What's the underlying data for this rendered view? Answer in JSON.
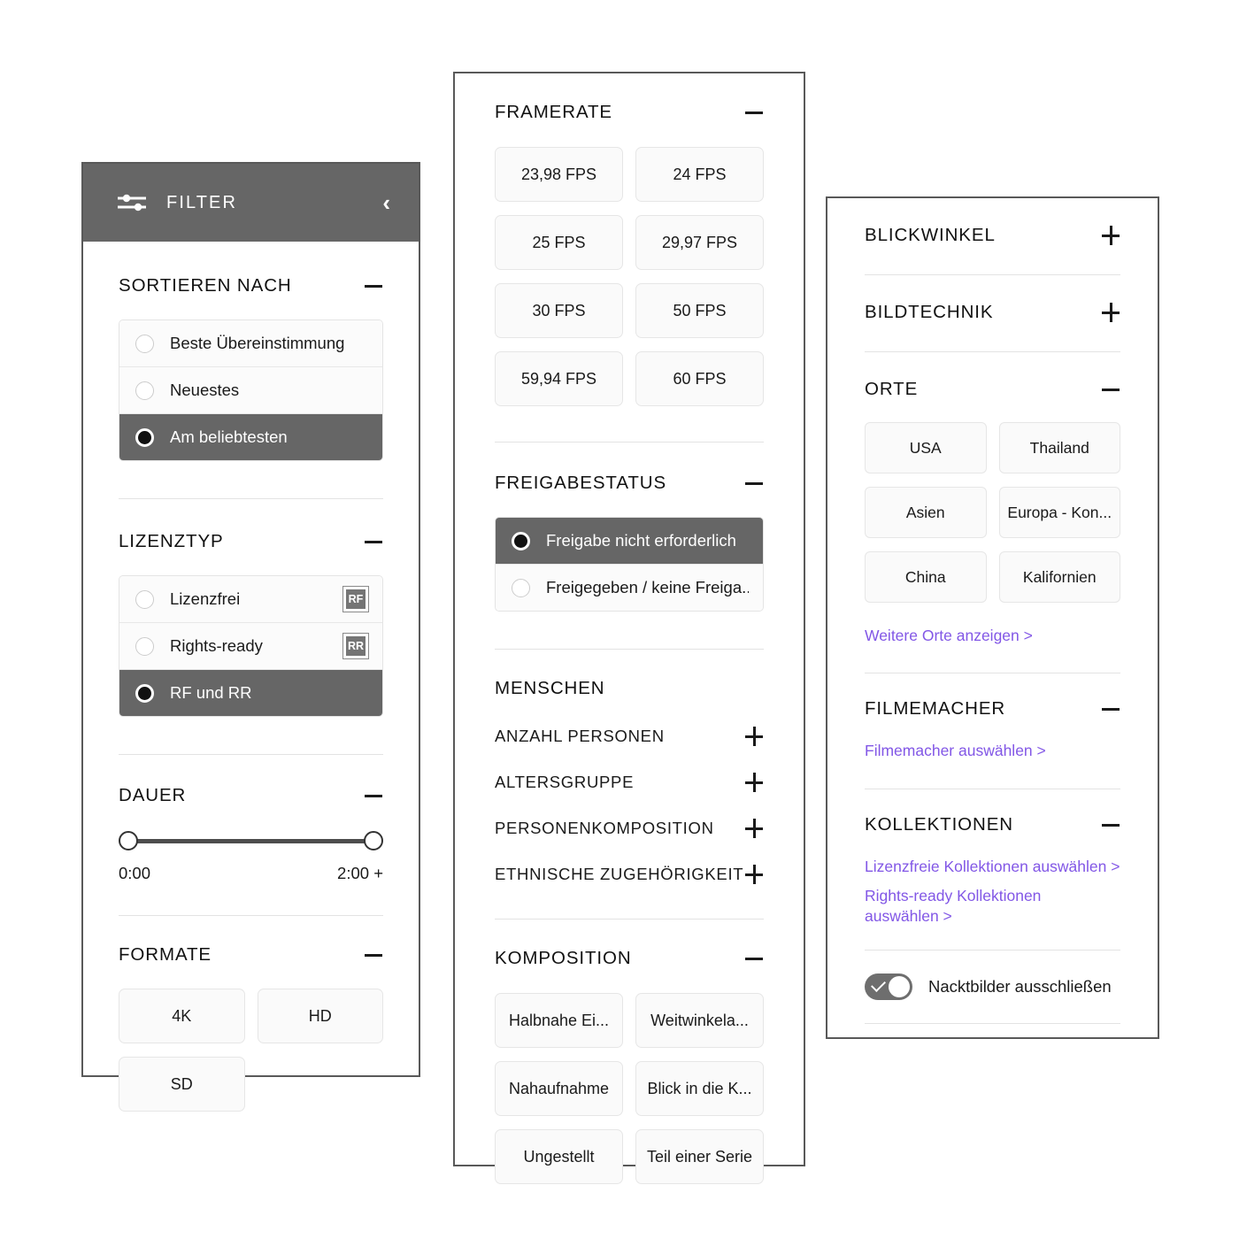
{
  "colors": {
    "panel_border": "#595959",
    "header_bg": "#666666",
    "selected_row_bg": "#666666",
    "link": "#8257e6",
    "chip_bg": "#fafafa"
  },
  "left_panel": {
    "header": {
      "icon": "sliders-icon",
      "title": "FILTER",
      "collapse_icon": "chevron-left-icon"
    },
    "sort": {
      "title": "SORTIEREN NACH",
      "toggle": "−",
      "options": [
        {
          "label": "Beste Übereinstimmung",
          "selected": false
        },
        {
          "label": "Neuestes",
          "selected": false
        },
        {
          "label": "Am beliebtesten",
          "selected": true
        }
      ]
    },
    "license": {
      "title": "LIZENZTYP",
      "toggle": "−",
      "options": [
        {
          "label": "Lizenzfrei",
          "selected": false,
          "badge": "RF"
        },
        {
          "label": "Rights-ready",
          "selected": false,
          "badge": "RR"
        },
        {
          "label": "RF und RR",
          "selected": true,
          "badge": ""
        }
      ]
    },
    "duration": {
      "title": "DAUER",
      "toggle": "−",
      "min_label": "0:00",
      "max_label": "2:00 +"
    },
    "formats": {
      "title": "FORMATE",
      "toggle": "−",
      "chips": [
        "4K",
        "HD",
        "SD"
      ]
    }
  },
  "mid_panel": {
    "framerate": {
      "title": "FRAMERATE",
      "toggle": "−",
      "chips": [
        "23,98 FPS",
        "24 FPS",
        "25 FPS",
        "29,97 FPS",
        "30 FPS",
        "50 FPS",
        "59,94 FPS",
        "60 FPS"
      ]
    },
    "release": {
      "title": "FREIGABESTATUS",
      "toggle": "−",
      "options": [
        {
          "label": "Freigabe nicht erforderlich",
          "selected": true
        },
        {
          "label": "Freigegeben / keine Freiga...",
          "selected": false
        }
      ]
    },
    "people": {
      "title": "MENSCHEN",
      "subsections": [
        {
          "label": "ANZAHL PERSONEN",
          "toggle": "+"
        },
        {
          "label": "ALTERSGRUPPE",
          "toggle": "+"
        },
        {
          "label": "PERSONENKOMPOSITION",
          "toggle": "+"
        },
        {
          "label": "ETHNISCHE ZUGEHÖRIGKEIT",
          "toggle": "+"
        }
      ]
    },
    "composition": {
      "title": "KOMPOSITION",
      "toggle": "−",
      "chips": [
        "Halbnahe Ei...",
        "Weitwinkela...",
        "Nahaufnahme",
        "Blick in die K...",
        "Ungestellt",
        "Teil einer Serie"
      ]
    }
  },
  "right_panel": {
    "viewpoint": {
      "title": "BLICKWINKEL",
      "toggle": "+"
    },
    "imaging": {
      "title": "BILDTECHNIK",
      "toggle": "+"
    },
    "places": {
      "title": "ORTE",
      "toggle": "−",
      "chips": [
        "USA",
        "Thailand",
        "Asien",
        "Europa - Kon...",
        "China",
        "Kalifornien"
      ],
      "more_link": "Weitere Orte anzeigen >"
    },
    "filmmaker": {
      "title": "FILMEMACHER",
      "toggle": "−",
      "link": "Filmemacher auswählen >"
    },
    "collections": {
      "title": "KOLLEKTIONEN",
      "toggle": "−",
      "links": [
        "Lizenzfreie Kollektionen auswählen >",
        "Rights-ready Kollektionen auswählen >"
      ]
    },
    "nudity_toggle": {
      "label": "Nacktbilder ausschließen",
      "on": true,
      "icon": "check-icon"
    }
  }
}
